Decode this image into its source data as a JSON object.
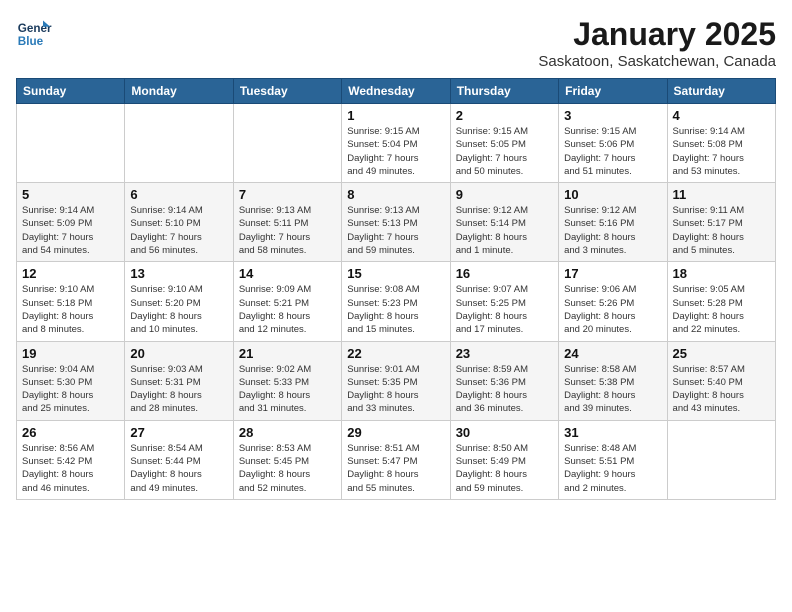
{
  "logo": {
    "line1": "General",
    "line2": "Blue"
  },
  "title": "January 2025",
  "subtitle": "Saskatoon, Saskatchewan, Canada",
  "days_of_week": [
    "Sunday",
    "Monday",
    "Tuesday",
    "Wednesday",
    "Thursday",
    "Friday",
    "Saturday"
  ],
  "weeks": [
    [
      {
        "day": "",
        "info": ""
      },
      {
        "day": "",
        "info": ""
      },
      {
        "day": "",
        "info": ""
      },
      {
        "day": "1",
        "info": "Sunrise: 9:15 AM\nSunset: 5:04 PM\nDaylight: 7 hours\nand 49 minutes."
      },
      {
        "day": "2",
        "info": "Sunrise: 9:15 AM\nSunset: 5:05 PM\nDaylight: 7 hours\nand 50 minutes."
      },
      {
        "day": "3",
        "info": "Sunrise: 9:15 AM\nSunset: 5:06 PM\nDaylight: 7 hours\nand 51 minutes."
      },
      {
        "day": "4",
        "info": "Sunrise: 9:14 AM\nSunset: 5:08 PM\nDaylight: 7 hours\nand 53 minutes."
      }
    ],
    [
      {
        "day": "5",
        "info": "Sunrise: 9:14 AM\nSunset: 5:09 PM\nDaylight: 7 hours\nand 54 minutes."
      },
      {
        "day": "6",
        "info": "Sunrise: 9:14 AM\nSunset: 5:10 PM\nDaylight: 7 hours\nand 56 minutes."
      },
      {
        "day": "7",
        "info": "Sunrise: 9:13 AM\nSunset: 5:11 PM\nDaylight: 7 hours\nand 58 minutes."
      },
      {
        "day": "8",
        "info": "Sunrise: 9:13 AM\nSunset: 5:13 PM\nDaylight: 7 hours\nand 59 minutes."
      },
      {
        "day": "9",
        "info": "Sunrise: 9:12 AM\nSunset: 5:14 PM\nDaylight: 8 hours\nand 1 minute."
      },
      {
        "day": "10",
        "info": "Sunrise: 9:12 AM\nSunset: 5:16 PM\nDaylight: 8 hours\nand 3 minutes."
      },
      {
        "day": "11",
        "info": "Sunrise: 9:11 AM\nSunset: 5:17 PM\nDaylight: 8 hours\nand 5 minutes."
      }
    ],
    [
      {
        "day": "12",
        "info": "Sunrise: 9:10 AM\nSunset: 5:18 PM\nDaylight: 8 hours\nand 8 minutes."
      },
      {
        "day": "13",
        "info": "Sunrise: 9:10 AM\nSunset: 5:20 PM\nDaylight: 8 hours\nand 10 minutes."
      },
      {
        "day": "14",
        "info": "Sunrise: 9:09 AM\nSunset: 5:21 PM\nDaylight: 8 hours\nand 12 minutes."
      },
      {
        "day": "15",
        "info": "Sunrise: 9:08 AM\nSunset: 5:23 PM\nDaylight: 8 hours\nand 15 minutes."
      },
      {
        "day": "16",
        "info": "Sunrise: 9:07 AM\nSunset: 5:25 PM\nDaylight: 8 hours\nand 17 minutes."
      },
      {
        "day": "17",
        "info": "Sunrise: 9:06 AM\nSunset: 5:26 PM\nDaylight: 8 hours\nand 20 minutes."
      },
      {
        "day": "18",
        "info": "Sunrise: 9:05 AM\nSunset: 5:28 PM\nDaylight: 8 hours\nand 22 minutes."
      }
    ],
    [
      {
        "day": "19",
        "info": "Sunrise: 9:04 AM\nSunset: 5:30 PM\nDaylight: 8 hours\nand 25 minutes."
      },
      {
        "day": "20",
        "info": "Sunrise: 9:03 AM\nSunset: 5:31 PM\nDaylight: 8 hours\nand 28 minutes."
      },
      {
        "day": "21",
        "info": "Sunrise: 9:02 AM\nSunset: 5:33 PM\nDaylight: 8 hours\nand 31 minutes."
      },
      {
        "day": "22",
        "info": "Sunrise: 9:01 AM\nSunset: 5:35 PM\nDaylight: 8 hours\nand 33 minutes."
      },
      {
        "day": "23",
        "info": "Sunrise: 8:59 AM\nSunset: 5:36 PM\nDaylight: 8 hours\nand 36 minutes."
      },
      {
        "day": "24",
        "info": "Sunrise: 8:58 AM\nSunset: 5:38 PM\nDaylight: 8 hours\nand 39 minutes."
      },
      {
        "day": "25",
        "info": "Sunrise: 8:57 AM\nSunset: 5:40 PM\nDaylight: 8 hours\nand 43 minutes."
      }
    ],
    [
      {
        "day": "26",
        "info": "Sunrise: 8:56 AM\nSunset: 5:42 PM\nDaylight: 8 hours\nand 46 minutes."
      },
      {
        "day": "27",
        "info": "Sunrise: 8:54 AM\nSunset: 5:44 PM\nDaylight: 8 hours\nand 49 minutes."
      },
      {
        "day": "28",
        "info": "Sunrise: 8:53 AM\nSunset: 5:45 PM\nDaylight: 8 hours\nand 52 minutes."
      },
      {
        "day": "29",
        "info": "Sunrise: 8:51 AM\nSunset: 5:47 PM\nDaylight: 8 hours\nand 55 minutes."
      },
      {
        "day": "30",
        "info": "Sunrise: 8:50 AM\nSunset: 5:49 PM\nDaylight: 8 hours\nand 59 minutes."
      },
      {
        "day": "31",
        "info": "Sunrise: 8:48 AM\nSunset: 5:51 PM\nDaylight: 9 hours\nand 2 minutes."
      },
      {
        "day": "",
        "info": ""
      }
    ]
  ]
}
